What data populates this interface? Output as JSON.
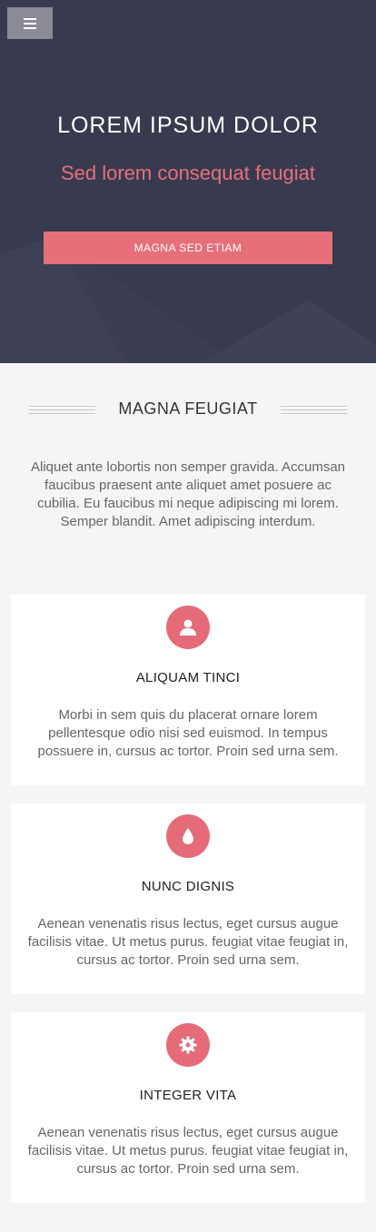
{
  "header": {
    "menu_icon": "hamburger-menu-icon",
    "title": "LOREM IPSUM DOLOR",
    "subtitle": "Sed lorem consequat feugiat",
    "cta_label": "MAGNA SED ETIAM"
  },
  "intro": {
    "heading": "MAGNA FEUGIAT",
    "text": "Aliquet ante lobortis non semper gravida. Accumsan faucibus praesent ante aliquet amet posuere ac cubilia. Eu faucibus mi neque adipiscing mi lorem. Semper blandit. Amet adipiscing interdum."
  },
  "features": [
    {
      "icon": "user-icon",
      "title": "ALIQUAM TINCI",
      "text": "Morbi in sem quis du placerat ornare lorem pellentesque odio nisi sed euismod. In tempus possuere in, cursus ac tortor. Proin sed urna sem."
    },
    {
      "icon": "drop-icon",
      "title": "NUNC DIGNIS",
      "text": "Aenean venenatis risus lectus, eget cursus augue facilisis vitae. Ut metus purus. feugiat vitae feugiat in, cursus ac tortor. Proin sed urna sem."
    },
    {
      "icon": "gear-icon",
      "title": "INTEGER VITA",
      "text": "Aenean venenatis risus lectus, eget cursus augue facilisis vitae. Ut metus purus. feugiat vitae feugiat in, cursus ac tortor. Proin sed urna sem."
    }
  ],
  "colors": {
    "hero_bg": "#383a4f",
    "accent": "#e76f7a",
    "page_bg": "#f5f5f5",
    "card_bg": "#ffffff"
  }
}
